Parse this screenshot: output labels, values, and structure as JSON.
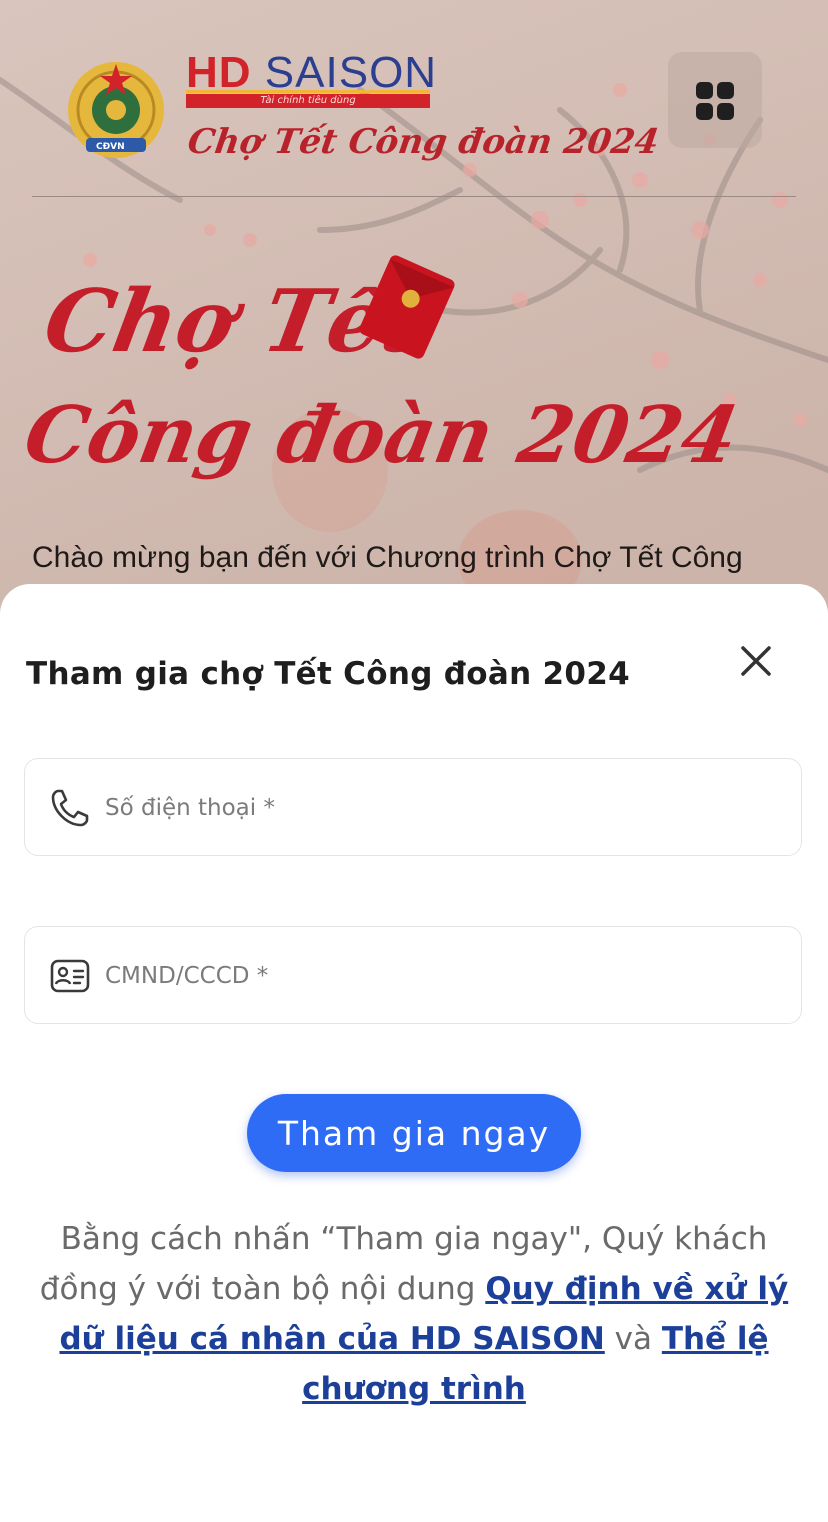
{
  "header": {
    "brand_hd": "HD",
    "brand_saison": "SAISON",
    "brand_tagline": "Tài chính tiêu dùng",
    "event_title": "Chợ Tết Công đoàn 2024",
    "union_logo_text": "CĐVN"
  },
  "hero": {
    "title_line1": "Chợ Tết",
    "title_line2": "Công đoàn 2024",
    "welcome_text": "Chào mừng bạn đến với Chương trình Chợ Tết Công"
  },
  "sheet": {
    "title": "Tham gia chợ Tết Công đoàn 2024",
    "close_icon": "close-icon",
    "phone_field": {
      "placeholder": "Số điện thoại *",
      "value": "",
      "icon": "phone-icon"
    },
    "id_field": {
      "placeholder": "CMND/CCCD *",
      "value": "",
      "icon": "id-card-icon"
    },
    "submit_label": "Tham gia ngay",
    "consent": {
      "prefix": "Bằng cách nhấn “Tham gia ngay\", Quý khách đồng ý với toàn bộ nội dung ",
      "privacy_link": "Quy định về xử lý dữ liệu cá nhân của HD SAISON",
      "conjunction": " và ",
      "rules_link": "Thể lệ chương trình"
    }
  },
  "colors": {
    "accent_blue": "#2f6cf6",
    "link_blue": "#1c3f9a",
    "brand_red": "#d2232a",
    "brand_navy": "#2c3e8f"
  }
}
